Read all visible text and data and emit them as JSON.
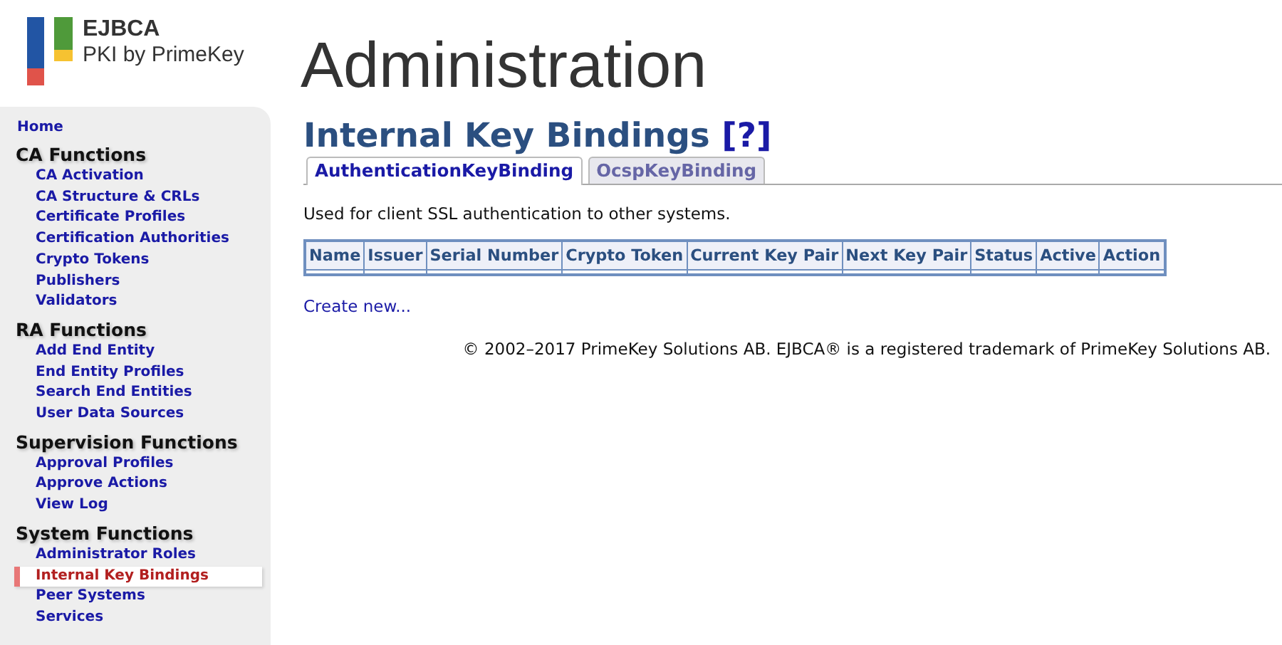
{
  "logo": {
    "title": "EJBCA",
    "subtitle": "PKI by PrimeKey"
  },
  "page_title": "Administration",
  "sidebar": {
    "home": {
      "label": "Home",
      "selected": false
    },
    "sections": [
      {
        "title": "CA Functions",
        "items": [
          {
            "label": "CA Activation",
            "selected": false
          },
          {
            "label": "CA Structure & CRLs",
            "selected": false
          },
          {
            "label": "Certificate Profiles",
            "selected": false
          },
          {
            "label": "Certification Authorities",
            "selected": false
          },
          {
            "label": "Crypto Tokens",
            "selected": false
          },
          {
            "label": "Publishers",
            "selected": false
          },
          {
            "label": "Validators",
            "selected": false
          }
        ]
      },
      {
        "title": "RA Functions",
        "items": [
          {
            "label": "Add End Entity",
            "selected": false
          },
          {
            "label": "End Entity Profiles",
            "selected": false
          },
          {
            "label": "Search End Entities",
            "selected": false
          },
          {
            "label": "User Data Sources",
            "selected": false
          }
        ]
      },
      {
        "title": "Supervision Functions",
        "items": [
          {
            "label": "Approval Profiles",
            "selected": false
          },
          {
            "label": "Approve Actions",
            "selected": false
          },
          {
            "label": "View Log",
            "selected": false
          }
        ]
      },
      {
        "title": "System Functions",
        "items": [
          {
            "label": "Administrator Roles",
            "selected": false
          },
          {
            "label": "Internal Key Bindings",
            "selected": true
          },
          {
            "label": "Peer Systems",
            "selected": false
          },
          {
            "label": "Services",
            "selected": false
          }
        ]
      }
    ]
  },
  "heading": {
    "title": "Internal Key Bindings",
    "help": "[?]"
  },
  "tabs": [
    {
      "label": "AuthenticationKeyBinding",
      "selected": true
    },
    {
      "label": "OcspKeyBinding",
      "selected": false
    }
  ],
  "description": "Used for client SSL authentication to other systems.",
  "table": {
    "columns": [
      "Name",
      "Issuer",
      "Serial Number",
      "Crypto Token",
      "Current Key Pair",
      "Next Key Pair",
      "Status",
      "Active",
      "Action"
    ]
  },
  "create_link": "Create new...",
  "footer": "© 2002–2017 PrimeKey Solutions AB. EJBCA® is a registered trademark of PrimeKey Solutions AB."
}
